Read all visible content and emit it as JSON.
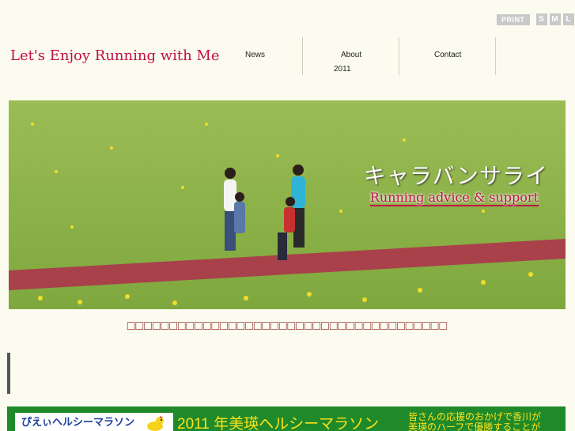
{
  "site": {
    "title": "Let's Enjoy Running with Me"
  },
  "utility": {
    "print_label": "PRINT",
    "sizes": [
      "S",
      "M",
      "L"
    ]
  },
  "nav": {
    "items": [
      {
        "label": "News"
      },
      {
        "label": "About"
      },
      {
        "label": "Contact"
      }
    ],
    "sub_label": "2011"
  },
  "hero": {
    "title": "キャラバンサライ",
    "subtitle": "Running  advice & support"
  },
  "notice": {
    "text": "□□□□□□□□□□□□□□□□□□□□□□□□□□□□□□□□□□□□□□"
  },
  "banner": {
    "logo_text": "ぴえぃヘルシーマラソン",
    "title": "2011  年美瑛ヘルシーマラソン",
    "message_line1": "皆さんの応援のおかげで香川が",
    "message_line2": "美瑛のハーフで優勝することが"
  },
  "colors": {
    "accent": "#c0104a",
    "background": "#fbfbef",
    "banner_green": "#1f8a2a",
    "banner_text": "#ffe21a"
  }
}
